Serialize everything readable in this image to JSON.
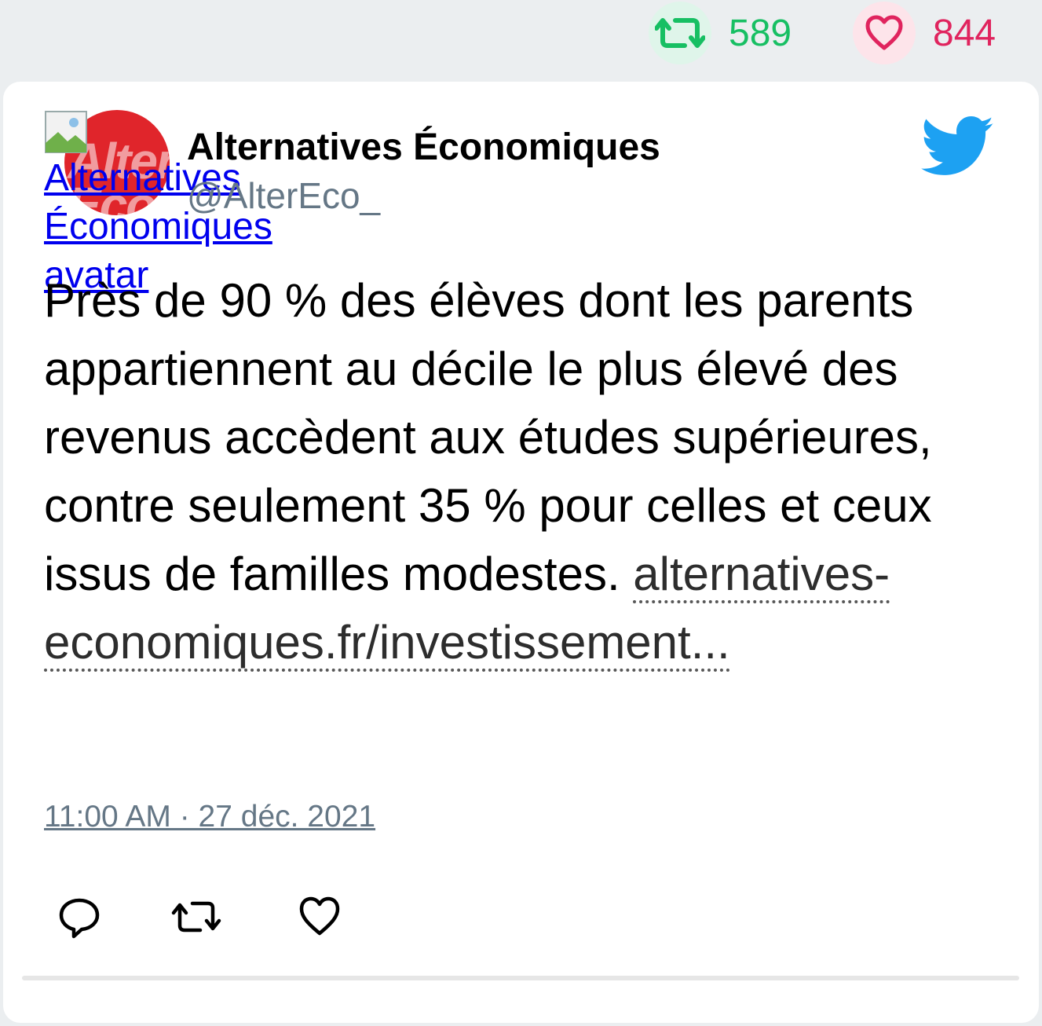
{
  "stats": {
    "retweet_count": "589",
    "like_count": "844",
    "retweet_color": "#17bf63",
    "like_color": "#e0245e"
  },
  "author": {
    "avatar_alt": "Alternatives Économiques avatar",
    "name": "Alternatives Économiques",
    "handle": "@AlterEco_"
  },
  "tweet": {
    "text": "Près de 90 % des élèves dont les parents appartiennent au décile le plus élevé des revenus accèdent aux études supérieures, contre seulement 35 % pour celles et ceux issus de familles modestes.",
    "link_text": "alternatives-economiques.fr/investissement...",
    "timestamp": "11:00 AM · 27 déc. 2021"
  },
  "icons": {
    "top_retweet": "retweet-icon",
    "top_like": "heart-icon",
    "logo": "twitter-bird-icon",
    "reply": "reply-icon",
    "retweet": "retweet-icon",
    "like": "heart-icon"
  }
}
